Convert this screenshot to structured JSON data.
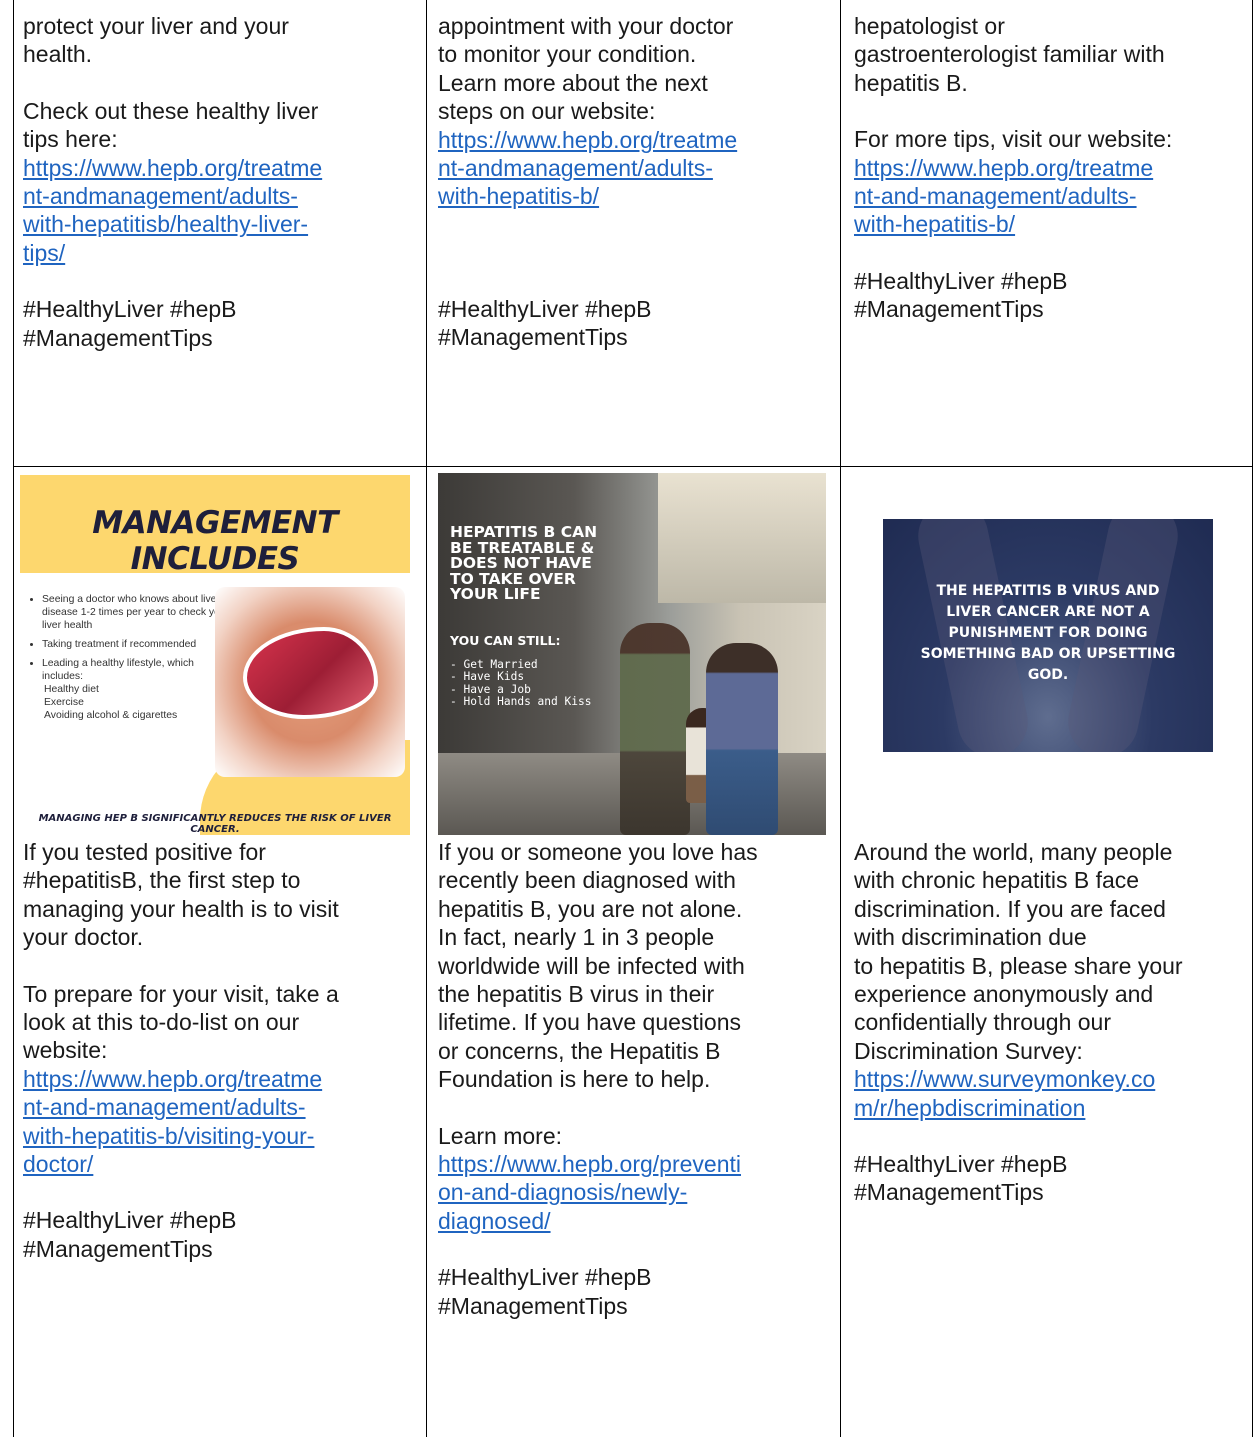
{
  "row1": {
    "col1": {
      "intro": "protect your liver and your\nhealth.",
      "lead": "Check out these healthy liver\ntips here:",
      "link": "https://www.hepb.org/treatme\nnt-andmanagement/adults-\nwith-hepatitisb/healthy-liver-\ntips/",
      "tags": "#HealthyLiver #hepB\n#ManagementTips"
    },
    "col2": {
      "intro": "appointment with your doctor\nto monitor your condition.\nLearn more about the next\nsteps on our website:",
      "link": "https://www.hepb.org/treatme\nnt-andmanagement/adults-\nwith-hepatitis-b/",
      "tags": "#HealthyLiver #hepB\n#ManagementTips"
    },
    "col3": {
      "intro": "hepatologist or\ngastroenterologist familiar with\nhepatitis B.",
      "lead": "For more tips, visit our website:",
      "link": "https://www.hepb.org/treatme\nnt-and-management/adults-\nwith-hepatitis-b/",
      "tags": "#HealthyLiver #hepB\n#ManagementTips"
    }
  },
  "row2": {
    "col1": {
      "image": {
        "title": "MANAGEMENT INCLUDES",
        "bullets": [
          "Seeing a doctor who knows about liver disease 1-2 times per year to check your liver health",
          "Taking treatment if recommended",
          "Leading a healthy lifestyle, which includes:"
        ],
        "subitems": "Healthy diet\nExercise\nAvoiding alcohol & cigarettes",
        "footer": "MANAGING HEP B SIGNIFICANTLY REDUCES THE RISK OF LIVER CANCER."
      },
      "intro": "If you tested positive for\n#hepatitisB, the first step to\nmanaging your health is to visit\nyour doctor.",
      "lead": "To prepare for your visit, take a\nlook at this to-do-list on our\nwebsite:",
      "link": "https://www.hepb.org/treatme\nnt-and-management/adults-\nwith-hepatitis-b/visiting-your-\ndoctor/",
      "tags": "#HealthyLiver #hepB\n#ManagementTips"
    },
    "col2": {
      "image": {
        "headline": "HEPATITIS B CAN\nBE TREATABLE &\nDOES NOT HAVE\nTO TAKE OVER\nYOUR LIFE",
        "subhead": "YOU CAN STILL:",
        "list": "- Get Married\n- Have Kids\n- Have a Job\n- Hold Hands and Kiss"
      },
      "intro": "If you or someone you love has\nrecently been diagnosed with\nhepatitis B, you are not alone.\nIn fact, nearly 1 in 3 people\nworldwide will be infected with\nthe hepatitis B virus in their\nlifetime. If you have questions\nor concerns, the Hepatitis B\nFoundation is here to help.",
      "lead": "Learn more:",
      "link": "https://www.hepb.org/preventi\non-and-diagnosis/newly-\ndiagnosed/",
      "tags": "#HealthyLiver #hepB\n#ManagementTips"
    },
    "col3": {
      "image": {
        "message": "THE HEPATITIS B VIRUS AND\nLIVER CANCER ARE NOT A\nPUNISHMENT FOR DOING\nSOMETHING BAD OR UPSETTING\nGOD."
      },
      "intro": "Around the world, many people\nwith chronic hepatitis B face\ndiscrimination. If you are faced\nwith discrimination due\nto hepatitis B, please share your\nexperience anonymously and\nconfidentially through our\nDiscrimination Survey:",
      "link": "https://www.surveymonkey.co\nm/r/hepbdiscrimination",
      "tags": "#HealthyLiver #hepB\n#ManagementTips"
    }
  }
}
